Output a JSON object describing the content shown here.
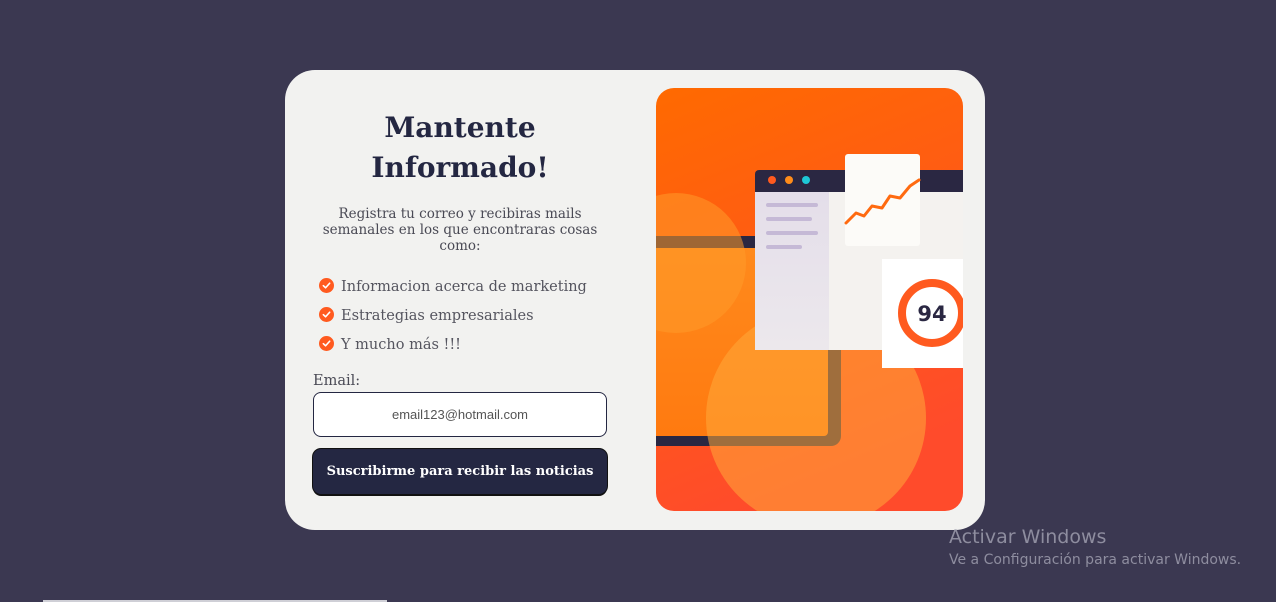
{
  "signup_card": {
    "title_line1": "Mantente",
    "title_line2": "Informado!",
    "description": "Registra tu correo y recibiras mails semanales en los que encontraras cosas como:",
    "benefits": [
      "Informacion acerca de marketing",
      "Estrategias empresariales",
      "Y mucho más !!!"
    ],
    "email_label": "Email:",
    "email_placeholder": "email123@hotmail.com",
    "submit_label": "Suscribirme para recibir las noticias"
  },
  "illustration": {
    "score": "94",
    "colors": {
      "gradient_top": "#ff6a00",
      "gradient_bottom": "#ff4b2b",
      "window_bar": "#2a2742",
      "dots": [
        "#ff5a1f",
        "#ff8c1a",
        "#1ec8d6"
      ]
    }
  },
  "watermark": {
    "title": "Activar Windows",
    "subtitle": "Ve a Configuración para activar Windows."
  },
  "theme": {
    "background": "#3b3851",
    "card": "#f2f2f0",
    "accent": "#ff5a1f",
    "dark": "#242742"
  }
}
